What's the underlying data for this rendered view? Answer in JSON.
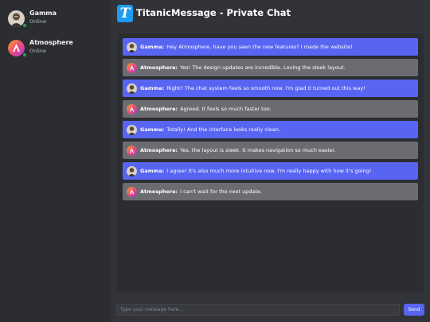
{
  "app": {
    "title": "TitanicMessage - Private Chat",
    "logo_letter": "T"
  },
  "users": [
    {
      "name": "Gamma",
      "status": "Online"
    },
    {
      "name": "Atmosphere",
      "status": "Online"
    }
  ],
  "messages": [
    {
      "sender": "Gamma:",
      "text": "Hey Atmosphere, have you seen the new features? I made the website!"
    },
    {
      "sender": "Atmosphere:",
      "text": "Yes! The design updates are incredible. Loving the sleek layout."
    },
    {
      "sender": "Gamma:",
      "text": "Right? The chat system feels so smooth now. I'm glad it turned out this way!"
    },
    {
      "sender": "Atmosphere:",
      "text": "Agreed. It feels so much faster too."
    },
    {
      "sender": "Gamma:",
      "text": "Totally! And the interface looks really clean."
    },
    {
      "sender": "Atmosphere:",
      "text": "Yes, the layout is sleek. It makes navigation so much easier."
    },
    {
      "sender": "Gamma:",
      "text": "I agree! It's also much more intuitive now. I'm really happy with how it's going!"
    },
    {
      "sender": "Atmosphere:",
      "text": "I can't wait for the next update."
    }
  ],
  "composer": {
    "placeholder": "Type your message here...",
    "send_label": "Send"
  },
  "colors": {
    "accent": "#5865f2",
    "online": "#23a55a",
    "other_bubble": "#6b6c72",
    "logo": "#1d9bf0"
  }
}
